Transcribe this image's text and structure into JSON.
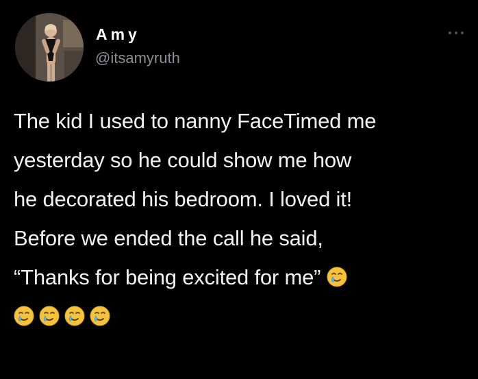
{
  "author": {
    "display_name": "Amy",
    "handle": "@itsamyruth"
  },
  "menu": {
    "icon": "more-dots-icon"
  },
  "tweet": {
    "lines": [
      "The kid I used to nanny FaceTimed me",
      "yesterday so he could show me how",
      "he decorated his bedroom. I loved it!",
      "Before we ended the call he said,",
      "“Thanks for being excited for me”"
    ],
    "emoji": "smiling-face-with-tear-emoji",
    "emoji_count_inline": 1,
    "emoji_count_trailing": 4
  },
  "colors": {
    "background": "#000000",
    "text": "#f2f2f2",
    "handle": "#8b8f93",
    "emoji_face": "#f5c33b"
  }
}
